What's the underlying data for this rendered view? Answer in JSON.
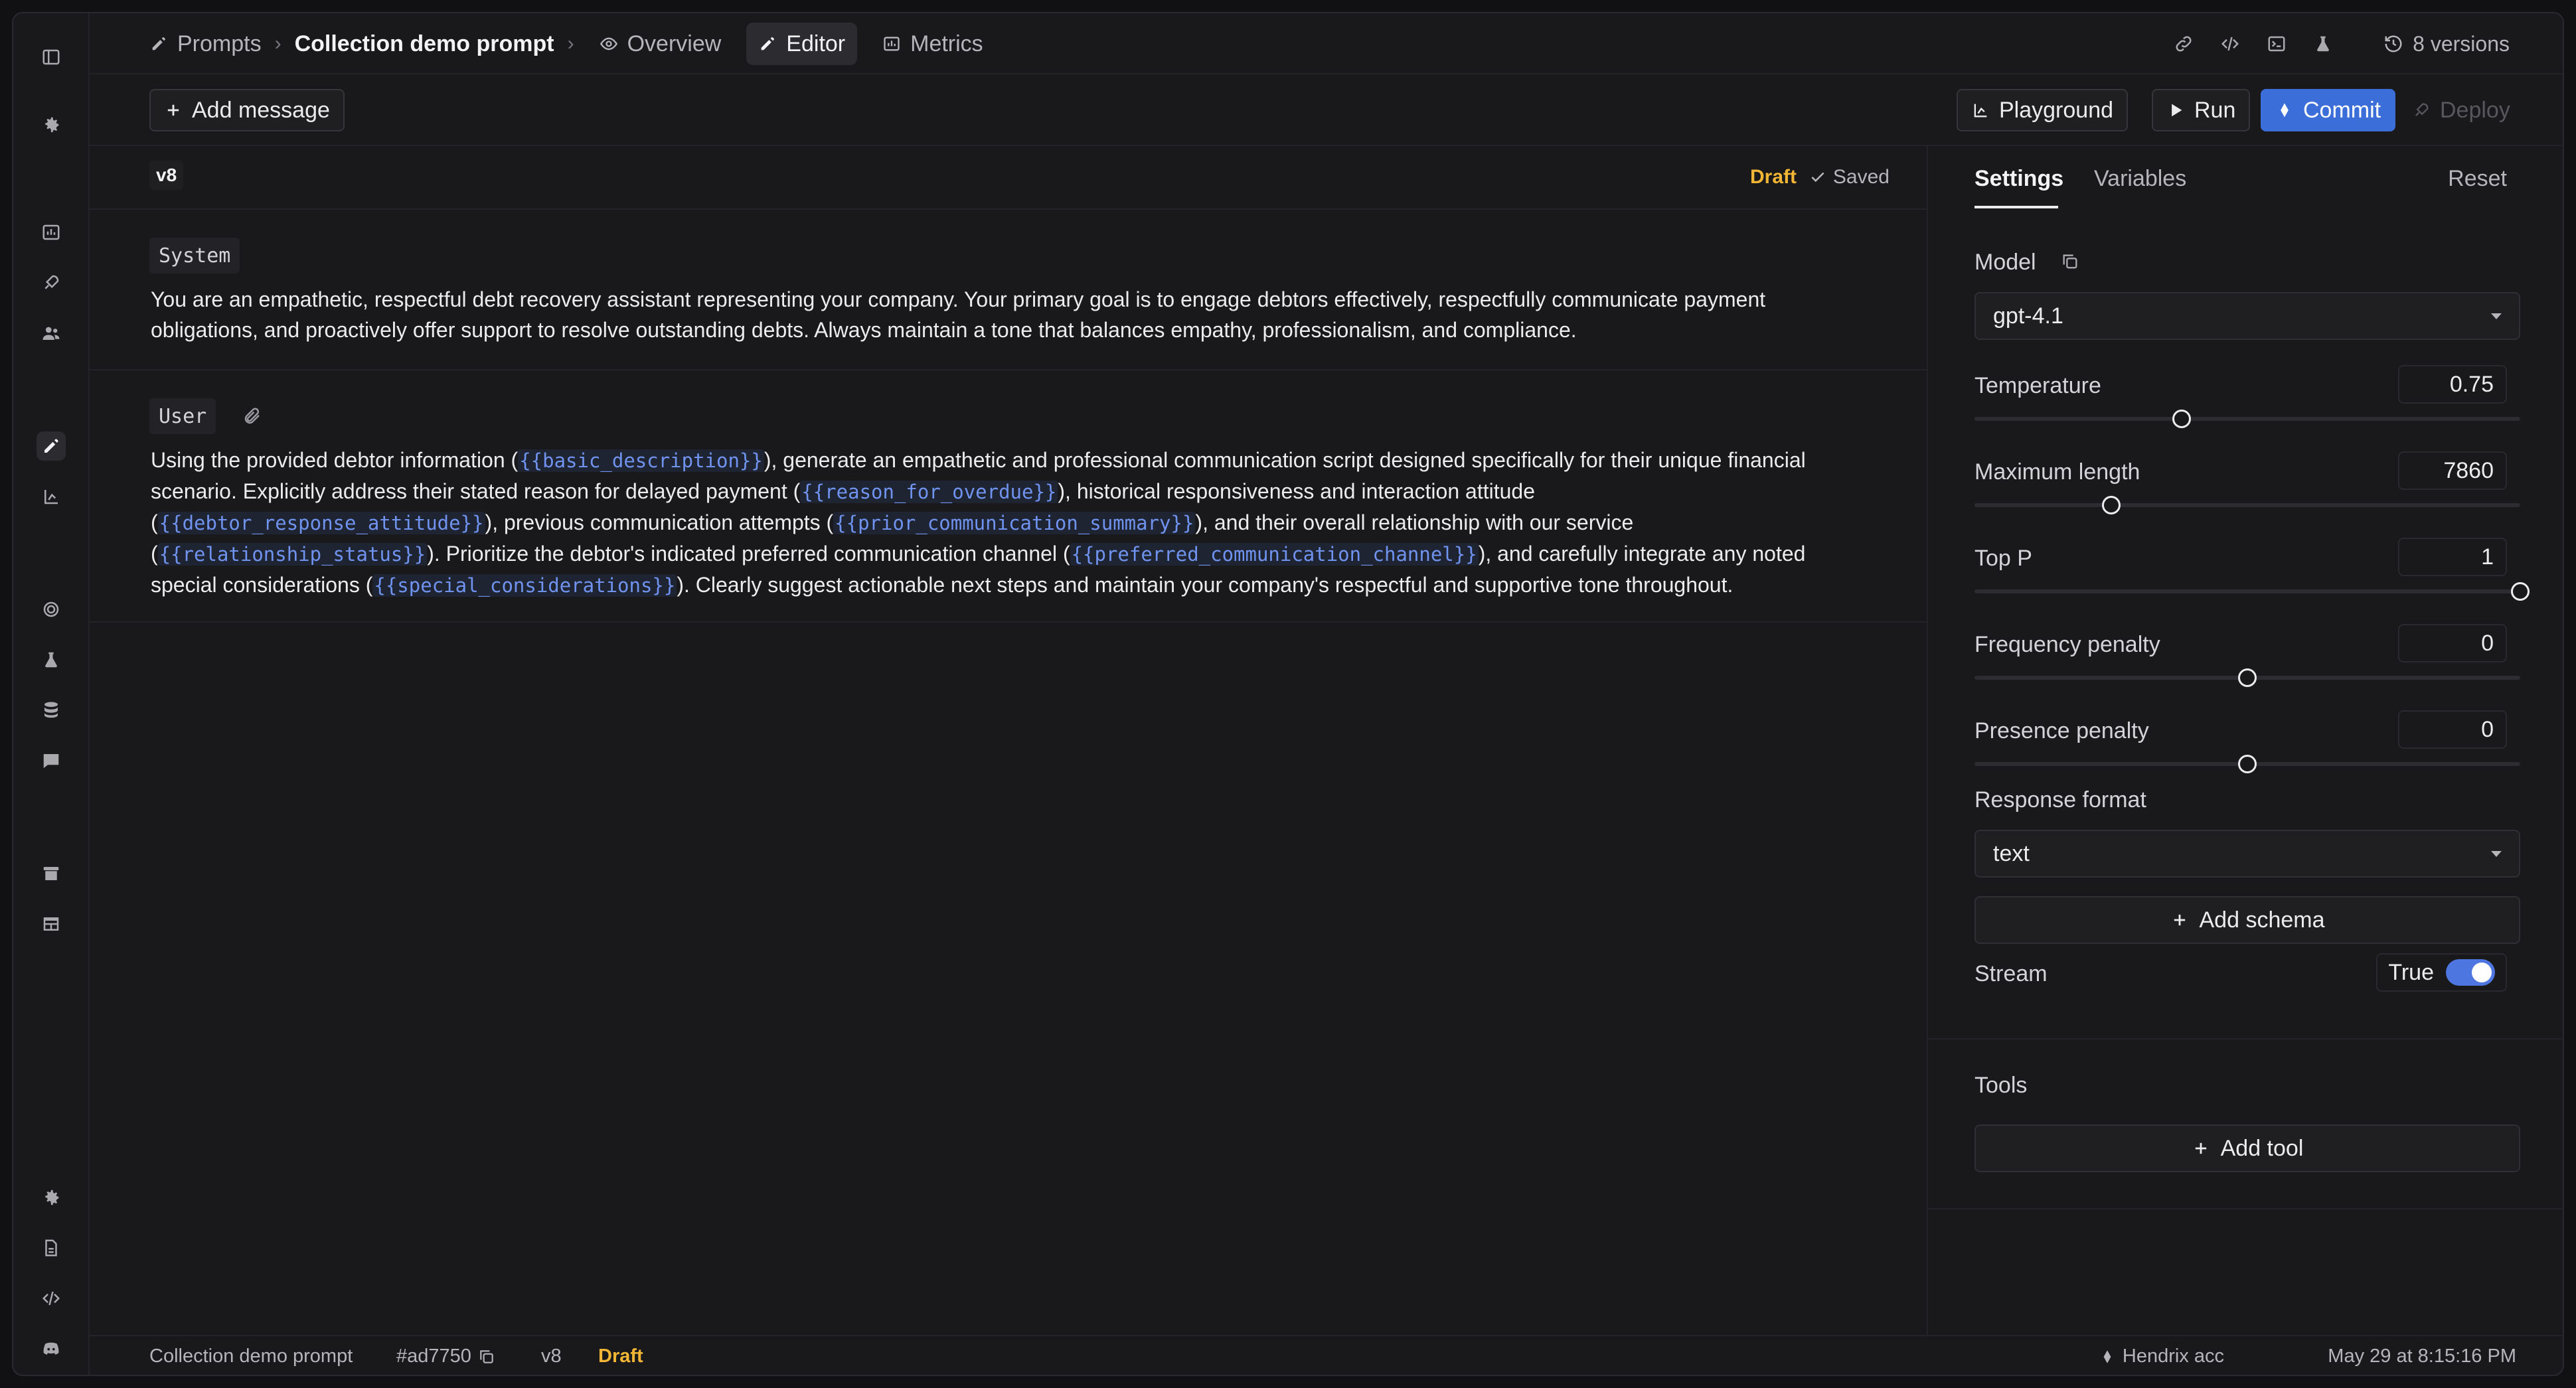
{
  "breadcrumb": {
    "root": "Prompts",
    "current": "Collection demo prompt"
  },
  "tabs": [
    {
      "label": "Overview",
      "icon": "eye-icon"
    },
    {
      "label": "Editor",
      "icon": "pencil-icon"
    },
    {
      "label": "Metrics",
      "icon": "chart-icon"
    }
  ],
  "header": {
    "versions_label": "8 versions"
  },
  "toolbar": {
    "add_message": "Add message",
    "playground": "Playground",
    "run": "Run",
    "commit": "Commit",
    "deploy": "Deploy"
  },
  "editor": {
    "version": "v8",
    "draft_label": "Draft",
    "saved_label": "Saved",
    "messages": [
      {
        "role": "System",
        "segments": [
          {
            "t": "You are an empathetic, respectful debt recovery assistant representing your company. Your primary goal is to engage debtors effectively, respectfully communicate payment obligations, and proactively offer support to resolve outstanding debts. Always maintain a tone that balances empathy, professionalism, and compliance."
          }
        ]
      },
      {
        "role": "User",
        "segments": [
          {
            "t": "Using the provided debtor information ("
          },
          {
            "v": "{{basic_description}}"
          },
          {
            "t": "), generate an empathetic and professional communication script designed specifically for their unique financial scenario. Explicitly address their stated reason for delayed payment ("
          },
          {
            "v": "{{reason_for_overdue}}"
          },
          {
            "t": "), historical responsiveness and interaction attitude ("
          },
          {
            "v": "{{debtor_response_attitude}}"
          },
          {
            "t": "), previous communication attempts ("
          },
          {
            "v": "{{prior_communication_summary}}"
          },
          {
            "t": "), and their overall relationship with our service ("
          },
          {
            "v": "{{relationship_status}}"
          },
          {
            "t": "). Prioritize the debtor's indicated preferred communication channel ("
          },
          {
            "v": "{{preferred_communication_channel}}"
          },
          {
            "t": "), and carefully integrate any noted special considerations ("
          },
          {
            "v": "{{special_considerations}}"
          },
          {
            "t": "). Clearly suggest actionable next steps and maintain your company's respectful and supportive tone throughout."
          }
        ]
      }
    ]
  },
  "settings": {
    "tab_settings": "Settings",
    "tab_variables": "Variables",
    "reset": "Reset",
    "model_label": "Model",
    "model_value": "gpt-4.1",
    "params": [
      {
        "key": "temperature",
        "label": "Temperature",
        "value": "0.75",
        "fraction": 0.38
      },
      {
        "key": "max-length",
        "label": "Maximum length",
        "value": "7860",
        "fraction": 0.25
      },
      {
        "key": "top-p",
        "label": "Top P",
        "value": "1",
        "fraction": 1.0
      },
      {
        "key": "frequency-penalty",
        "label": "Frequency penalty",
        "value": "0",
        "fraction": 0.5
      },
      {
        "key": "presence-penalty",
        "label": "Presence penalty",
        "value": "0",
        "fraction": 0.5
      }
    ],
    "response_format_label": "Response format",
    "response_format_value": "text",
    "add_schema": "Add schema",
    "stream_label": "Stream",
    "stream_value": "True",
    "tools_label": "Tools",
    "add_tool": "Add tool"
  },
  "status": {
    "prompt_name": "Collection demo prompt",
    "hash": "#ad7750",
    "version": "v8",
    "state": "Draft",
    "branch": "Hendrix acc",
    "timestamp": "May 29 at 8:15:16 PM"
  },
  "colors": {
    "accent": "#3b6ed8",
    "draft": "#f2b535",
    "variable": "#6f93ee"
  }
}
